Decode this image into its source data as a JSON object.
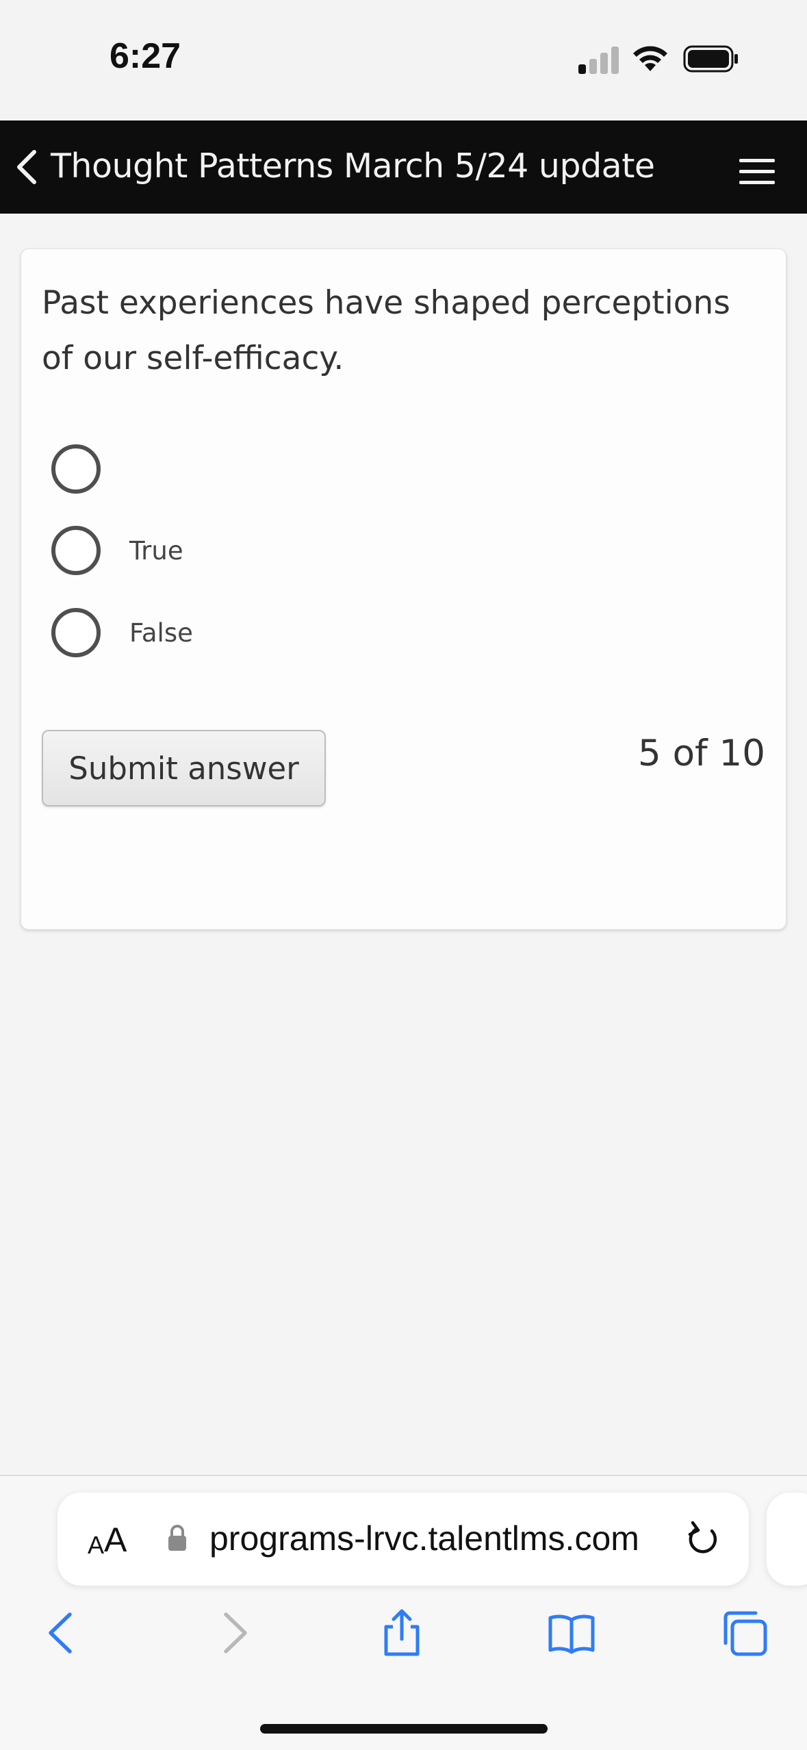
{
  "status_bar": {
    "time": "6:27"
  },
  "header": {
    "title": "Thought Patterns March 5/24 update",
    "back_icon": "chevron-left-icon",
    "menu_icon": "hamburger-menu-icon"
  },
  "question": {
    "text": "Past experiences have shaped perceptions of our self-efficacy.",
    "options": [
      {
        "label": "",
        "selected": false
      },
      {
        "label": "True",
        "selected": false
      },
      {
        "label": "False",
        "selected": false
      }
    ],
    "submit_label": "Submit answer",
    "progress": "5 of 10"
  },
  "browser": {
    "aa_small": "A",
    "aa_big": "A",
    "url": "programs-lrvc.talentlms.com",
    "lock_icon": "lock-icon",
    "reload_icon": "reload-icon"
  },
  "toolbar": {
    "icons": [
      "back-icon",
      "forward-icon",
      "share-icon",
      "bookmarks-icon",
      "tabs-icon"
    ]
  },
  "colors": {
    "header_bg": "#0d0d0d",
    "accent_blue": "#2f7cf6",
    "page_bg": "#f4f4f4"
  }
}
